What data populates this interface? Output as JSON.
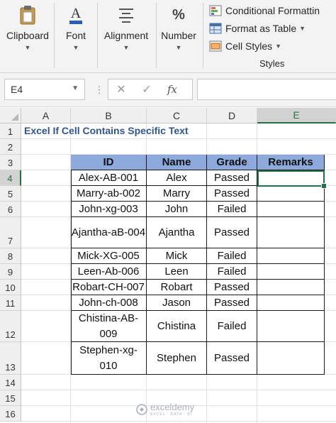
{
  "ribbon": {
    "clipboard": {
      "label": "Clipboard",
      "icon": "clipboard-icon"
    },
    "font": {
      "label": "Font",
      "icon": "font-color-icon"
    },
    "alignment": {
      "label": "Alignment",
      "icon": "align-icon"
    },
    "number": {
      "label": "Number",
      "icon": "percent-icon",
      "glyph": "%"
    },
    "styles": {
      "conditional_formatting": "Conditional Formattin",
      "format_as_table": "Format as Table",
      "cell_styles": "Cell Styles",
      "caption": "Styles"
    }
  },
  "formula_bar": {
    "name_box": "E4",
    "cancel_glyph": "✕",
    "enter_glyph": "✓",
    "fx_label": "fx",
    "formula": ""
  },
  "columns": [
    "A",
    "B",
    "C",
    "D",
    "E"
  ],
  "rows": [
    "1",
    "2",
    "3",
    "4",
    "5",
    "6",
    "7",
    "8",
    "9",
    "10",
    "11",
    "12",
    "13",
    "14",
    "15",
    "16"
  ],
  "sheet": {
    "title": "Excel If Cell Contains Specific Text",
    "headers": [
      "ID",
      "Name",
      "Grade",
      "Remarks"
    ],
    "records": [
      {
        "id": "Alex-AB-001",
        "name": "Alex",
        "grade": "Passed",
        "remarks": ""
      },
      {
        "id": "Marry-ab-002",
        "name": "Marry",
        "grade": "Passed",
        "remarks": ""
      },
      {
        "id": "John-xg-003",
        "name": "John",
        "grade": "Failed",
        "remarks": ""
      },
      {
        "id": "Ajantha-aB-004",
        "name": "Ajantha",
        "grade": "Passed",
        "remarks": ""
      },
      {
        "id": "Mick-XG-005",
        "name": "Mick",
        "grade": "Failed",
        "remarks": ""
      },
      {
        "id": "Leen-Ab-006",
        "name": "Leen",
        "grade": "Failed",
        "remarks": ""
      },
      {
        "id": "Robart-CH-007",
        "name": "Robart",
        "grade": "Passed",
        "remarks": ""
      },
      {
        "id": "John-ch-008",
        "name": "Jason",
        "grade": "Passed",
        "remarks": ""
      },
      {
        "id": "Chistina-AB-009",
        "name": "Chistina",
        "grade": "Failed",
        "remarks": ""
      },
      {
        "id": "Stephen-xg-010",
        "name": "Stephen",
        "grade": "Passed",
        "remarks": ""
      }
    ]
  },
  "selection": {
    "cell": "E4",
    "column": "E",
    "row": "4"
  },
  "watermark": {
    "name": "exceldemy",
    "tagline": "EXCEL · DATA · BI"
  },
  "colors": {
    "header_fill": "#8ea9db",
    "title": "#2f5597",
    "selection": "#217346"
  }
}
